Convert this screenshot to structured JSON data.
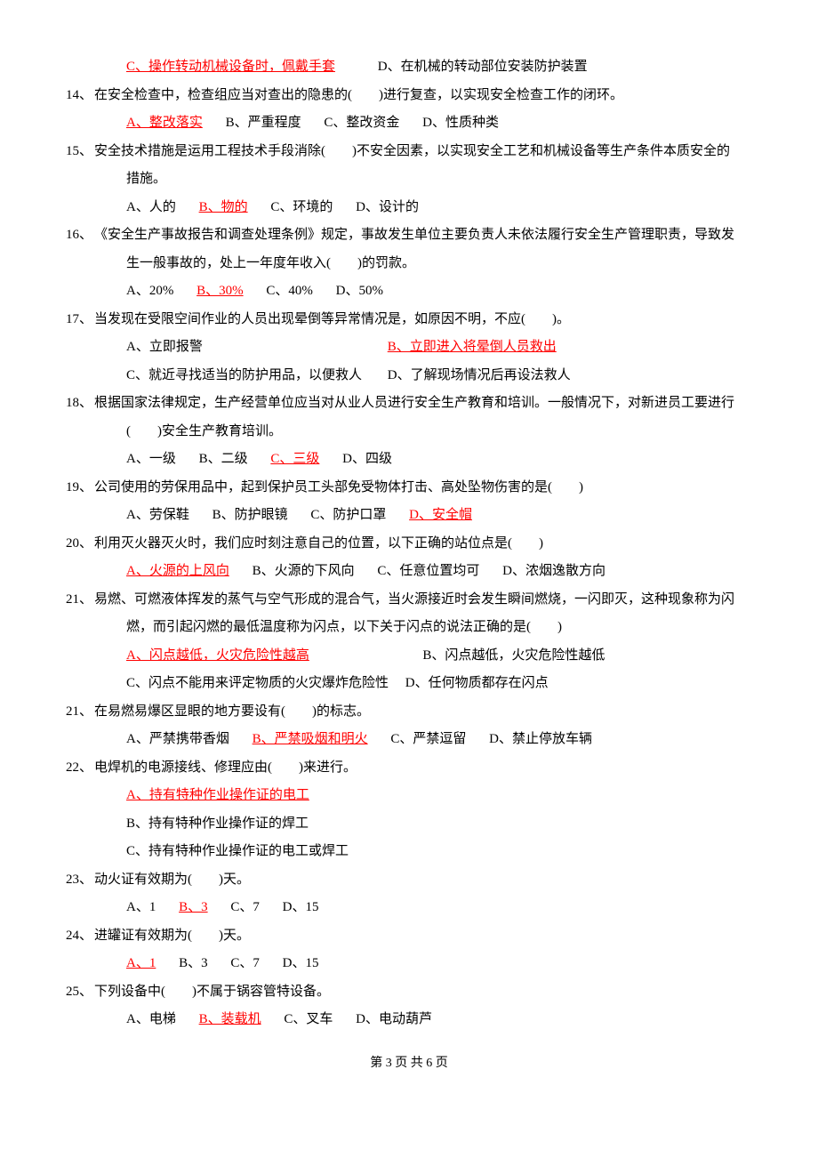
{
  "q13opts": {
    "c": "C、操作转动机械设备时，佩戴手套",
    "d": "D、在机械的转动部位安装防护装置"
  },
  "q14": {
    "num": "14、",
    "text": "在安全检查中，检查组应当对查出的隐患的(　　)进行复查，以实现安全检查工作的闭环。",
    "a": "A、整改落实",
    "b": "B、严重程度",
    "c": "C、整改资金",
    "d": "D、性质种类"
  },
  "q15": {
    "num": "15、",
    "text1": "安全技术措施是运用工程技术手段消除(　　)不安全因素，以实现安全工艺和机械设备等生产条件本质安全的",
    "text2": "措施。",
    "a": "A、人的",
    "b": "B、物的",
    "c": "C、环境的",
    "d": "D、设计的"
  },
  "q16": {
    "num": "16、",
    "text1": "《安全生产事故报告和调查处理条例》规定，事故发生单位主要负责人未依法履行安全生产管理职责，导致发",
    "text2": "生一般事故的，处上一年度年收入(　　)的罚款。",
    "a": "A、20%",
    "b": "B、30%",
    "c": "C、40%",
    "d": "D、50%"
  },
  "q17": {
    "num": "17、",
    "text": "当发现在受限空间作业的人员出现晕倒等异常情况是，如原因不明，不应(　　)。",
    "a": "A、立即报警",
    "b": "B、立即进入将晕倒人员救出",
    "c": "C、就近寻找适当的防护用品，以便救人",
    "d": "D、了解现场情况后再设法救人"
  },
  "q18": {
    "num": "18、",
    "text1": "根据国家法律规定，生产经营单位应当对从业人员进行安全生产教育和培训。一般情况下，对新进员工要进行",
    "text2": "(　　)安全生产教育培训。",
    "a": "A、一级",
    "b": "B、二级",
    "c": "C、三级",
    "d": "D、四级"
  },
  "q19": {
    "num": "19、",
    "text": "公司使用的劳保用品中，起到保护员工头部免受物体打击、高处坠物伤害的是(　　)",
    "a": "A、劳保鞋",
    "b": "B、防护眼镜",
    "c": "C、防护口罩",
    "d": "D、安全帽"
  },
  "q20": {
    "num": "20、",
    "text": "利用灭火器灭火时，我们应时刻注意自己的位置，以下正确的站位点是(　　)",
    "a": "A、火源的上风向",
    "b": "B、火源的下风向",
    "c": "C、任意位置均可",
    "d": "D、浓烟逸散方向"
  },
  "q21a": {
    "num": "21、",
    "text1": "易燃、可燃液体挥发的蒸气与空气形成的混合气，当火源接近时会发生瞬间燃烧，一闪即灭，这种现象称为闪",
    "text2": "燃，而引起闪燃的最低温度称为闪点，以下关于闪点的说法正确的是(　　)",
    "a": "A、闪点越低，火灾危险性越高",
    "b": "B、闪点越低，火灾危险性越低",
    "c": "C、闪点不能用来评定物质的火灾爆炸危险性",
    "d": "D、任何物质都存在闪点"
  },
  "q21b": {
    "num": "21、",
    "text": "在易燃易爆区显眼的地方要设有(　　)的标志。",
    "a": "A、严禁携带香烟",
    "b": "B、严禁吸烟和明火",
    "c": "C、严禁逗留",
    "d": "D、禁止停放车辆"
  },
  "q22": {
    "num": "22、",
    "text": "电焊机的电源接线、修理应由(　　)来进行。",
    "a": "A、持有特种作业操作证的电工",
    "b": "B、持有特种作业操作证的焊工",
    "c": "C、持有特种作业操作证的电工或焊工"
  },
  "q23": {
    "num": "23、",
    "text": "动火证有效期为(　　)天。",
    "a": "A、1",
    "b": "B、3",
    "c": "C、7",
    "d": "D、15"
  },
  "q24": {
    "num": "24、",
    "text": "进罐证有效期为(　　)天。",
    "a": "A、1",
    "b": "B、3",
    "c": "C、7",
    "d": "D、15"
  },
  "q25": {
    "num": "25、",
    "text": "下列设备中(　　)不属于锅容管特设备。",
    "a": "A、电梯",
    "b": "B、装载机",
    "c": "C、叉车",
    "d": "D、电动葫芦"
  },
  "footer": "第 3 页 共 6 页"
}
